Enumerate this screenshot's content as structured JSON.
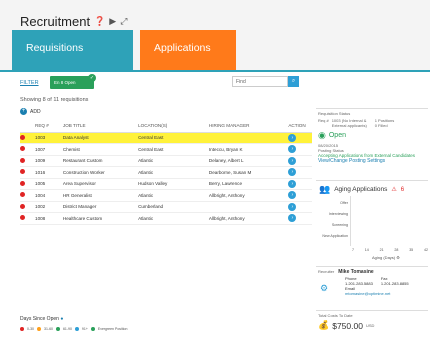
{
  "header": {
    "title": "Recruitment"
  },
  "tabs": [
    {
      "label": "Requisitions"
    },
    {
      "label": "Applications"
    }
  ],
  "filter": {
    "link": "FILTER",
    "chip": "En 8 Open",
    "find_placeholder": "Find"
  },
  "showing": "Showing 8 of 11 requisitions",
  "add": "ADD",
  "table": {
    "headers": [
      "",
      "REQ #",
      "JOB TITLE",
      "LOCATION(S)",
      "HIRING MANAGER",
      "ACTION"
    ],
    "rows": [
      {
        "req": "1003",
        "title": "Data Analyst",
        "loc": "Central East",
        "mgr": "",
        "selected": true
      },
      {
        "req": "1007",
        "title": "Chemist",
        "loc": "Central East",
        "mgr": "Inteccu, Bryan K",
        "selected": false
      },
      {
        "req": "1009",
        "title": "Restaurant Custom",
        "loc": "Atlantic",
        "mgr": "Delaney, Albert L",
        "selected": false
      },
      {
        "req": "1016",
        "title": "Construction Worker",
        "loc": "Atlantic",
        "mgr": "Dearborne, Susan M",
        "selected": false
      },
      {
        "req": "1005",
        "title": "Area Supervisor",
        "loc": "Hudson Valley",
        "mgr": "Berry, Lawrence",
        "selected": false
      },
      {
        "req": "1004",
        "title": "HR Generalist",
        "loc": "Atlantic",
        "mgr": "Allbright, Anthony",
        "selected": false
      },
      {
        "req": "1002",
        "title": "District Manager",
        "loc": "Cumberland",
        "mgr": "",
        "selected": false
      },
      {
        "req": "1008",
        "title": "Healthcare Custom",
        "loc": "Atlantic",
        "mgr": "Allbright, Anthony",
        "selected": false
      }
    ]
  },
  "days_since_open": "Days Since Open",
  "legend": [
    "0-30",
    "31-60",
    "61-90",
    "91+",
    "Evergreen Position"
  ],
  "colors": {
    "teal": "#2ea2b8",
    "orange": "#ff7a1a",
    "green": "#2aa05a",
    "blue": "#2e9fd6",
    "red": "#e02424"
  },
  "right": {
    "req_status": "Requisition Status",
    "req_label": "Req #",
    "req_value": "1003 (No Internal & External applicants)",
    "positions": "1 Positions",
    "filled": "0 Filled",
    "status": "Open",
    "status_date": "08/20/2015",
    "posting_status_label": "Posting Status",
    "posting_status": "Accepting Applications from External Candidates",
    "posting_link": "View/Change Posting Settings",
    "aging_title": "Aging Applications",
    "aging_count": "6",
    "aging_rows": [
      "Offer",
      "Interviewing",
      "Screening",
      "New Application"
    ],
    "aging_axis": [
      "7",
      "14",
      "21",
      "28",
      "35",
      "42"
    ],
    "aging_xlabel": "Aging (Days)",
    "recruiter_label": "Recruiter",
    "recruiter_name": "Mike Tomasine",
    "phone_label": "Phone",
    "phone": "1.201.283.5883",
    "fax_label": "Fax",
    "fax": "1.201.283.8855",
    "email_label": "Email",
    "email": "mtomasine@optimine.net",
    "cost_label": "Total Costs To Date",
    "cost": "$750.00",
    "cost_unit": "USD"
  }
}
